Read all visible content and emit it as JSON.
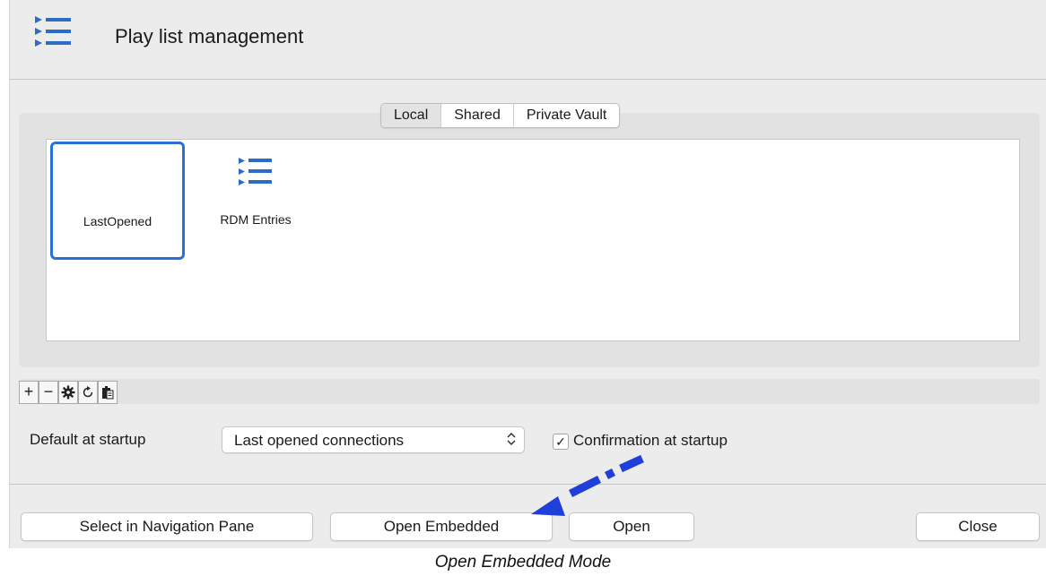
{
  "window": {
    "title": "Play list management",
    "title_icon": "playlist-icon"
  },
  "tabs": [
    {
      "label": "Local",
      "active": true
    },
    {
      "label": "Shared",
      "active": false
    },
    {
      "label": "Private Vault",
      "active": false
    }
  ],
  "playlists": [
    {
      "label": "LastOpened",
      "selected": true,
      "icon": null
    },
    {
      "label": "RDM Entries",
      "selected": false,
      "icon": "playlist-icon"
    }
  ],
  "toolbar": {
    "buttons": [
      {
        "name": "add-button",
        "glyph": "+"
      },
      {
        "name": "remove-button",
        "glyph": "−"
      },
      {
        "name": "settings-button",
        "icon": "gear-icon"
      },
      {
        "name": "refresh-button",
        "icon": "refresh-icon"
      },
      {
        "name": "paste-button",
        "icon": "clipboard-icon"
      }
    ]
  },
  "startup": {
    "label": "Default at startup",
    "selected_option": "Last opened connections",
    "confirmation_label": "Confirmation at startup",
    "confirmation_checked": true,
    "check_glyph": "✓",
    "arrows_glyph": "⌃⌄"
  },
  "footer_buttons": {
    "select_nav": "Select in Navigation Pane",
    "open_embedded": "Open Embedded",
    "open": "Open",
    "close": "Close"
  },
  "caption": "Open Embedded Mode",
  "colors": {
    "accent": "#2a6fd6",
    "icon_blue": "#2b6cc4",
    "annotation_arrow": "#1e3fd9"
  }
}
